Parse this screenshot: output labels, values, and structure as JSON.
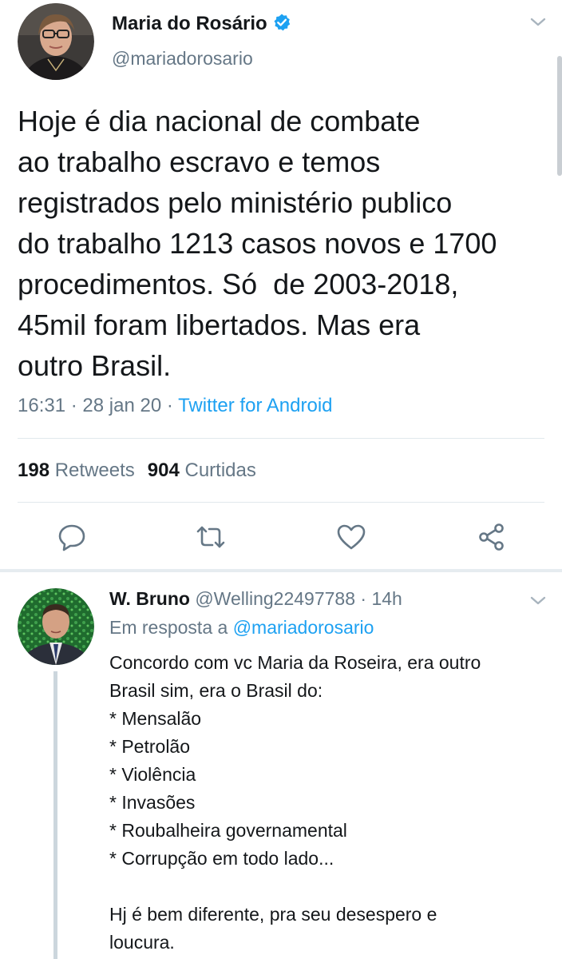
{
  "colors": {
    "text": "#14171a",
    "secondary": "#657786",
    "link": "#1da1f2",
    "divider": "#e1e8ed",
    "verified": "#1da1f2"
  },
  "tweet": {
    "author": {
      "name": "Maria do Rosário",
      "handle": "@mariadorosario",
      "verified": true
    },
    "text_lines": [
      "Hoje é dia nacional de combate",
      "ao trabalho escravo e temos",
      "registrados pelo ministério publico",
      "do trabalho 1213 casos novos e 1700",
      "procedimentos. Só  de 2003-2018,",
      "45mil foram libertados. Mas era",
      "outro Brasil."
    ],
    "time": "16:31",
    "date": "28 jan 20",
    "separator": "·",
    "source": "Twitter for Android",
    "retweets_count": "198",
    "retweets_label": "Retweets",
    "likes_count": "904",
    "likes_label": "Curtidas",
    "actions": {
      "reply_icon": "reply-icon",
      "retweet_icon": "retweet-icon",
      "like_icon": "heart-icon",
      "share_icon": "share-icon"
    }
  },
  "reply": {
    "name": "W. Bruno",
    "handle": "@Welling22497788",
    "separator": "·",
    "time": "14h",
    "in_reply_prefix": "Em resposta a",
    "in_reply_to": "@mariadorosario",
    "text_lines": [
      "Concordo com vc Maria da Roseira, era outro",
      "Brasil sim, era o Brasil do:",
      "* Mensalão",
      "* Petrolão",
      "* Violência",
      "* Invasões",
      "* Roubalheira governamental",
      "* Corrupção em todo lado...",
      "",
      "Hj é bem diferente, pra seu desespero e",
      "loucura."
    ]
  }
}
